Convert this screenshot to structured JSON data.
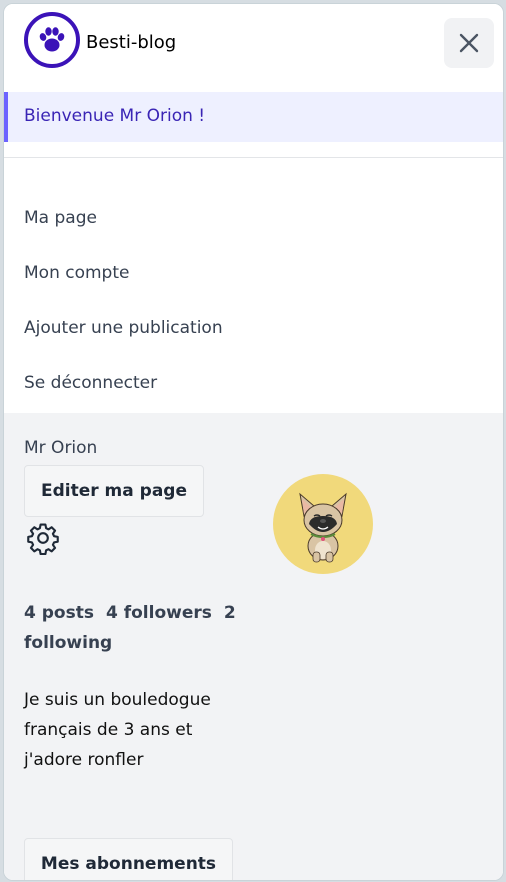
{
  "header": {
    "brand": "Besti-blog",
    "logo_icon": "paw-icon",
    "close_icon": "close-icon"
  },
  "welcome": {
    "text": "Bienvenue Mr Orion !"
  },
  "menu": {
    "items": [
      {
        "label": "Ma page"
      },
      {
        "label": "Mon compte"
      },
      {
        "label": "Ajouter une publication"
      },
      {
        "label": "Se déconnecter"
      }
    ]
  },
  "profile": {
    "name": "Mr Orion",
    "edit_label": "Editer ma page",
    "settings_icon": "gear-icon",
    "avatar_icon": "french-bulldog-avatar",
    "stats": {
      "posts": "4 posts",
      "followers": "4 followers",
      "following": "2 following"
    },
    "bio": "Je suis un bouledogue français de 3 ans et j'adore ronfler",
    "subscriptions_label": "Mes abonnements"
  },
  "colors": {
    "brand_purple": "#3b13b8",
    "welcome_bg": "#eef0ff",
    "welcome_accent": "#6c63ff",
    "avatar_bg": "#f1d97b",
    "profile_bg": "#f2f3f5"
  }
}
